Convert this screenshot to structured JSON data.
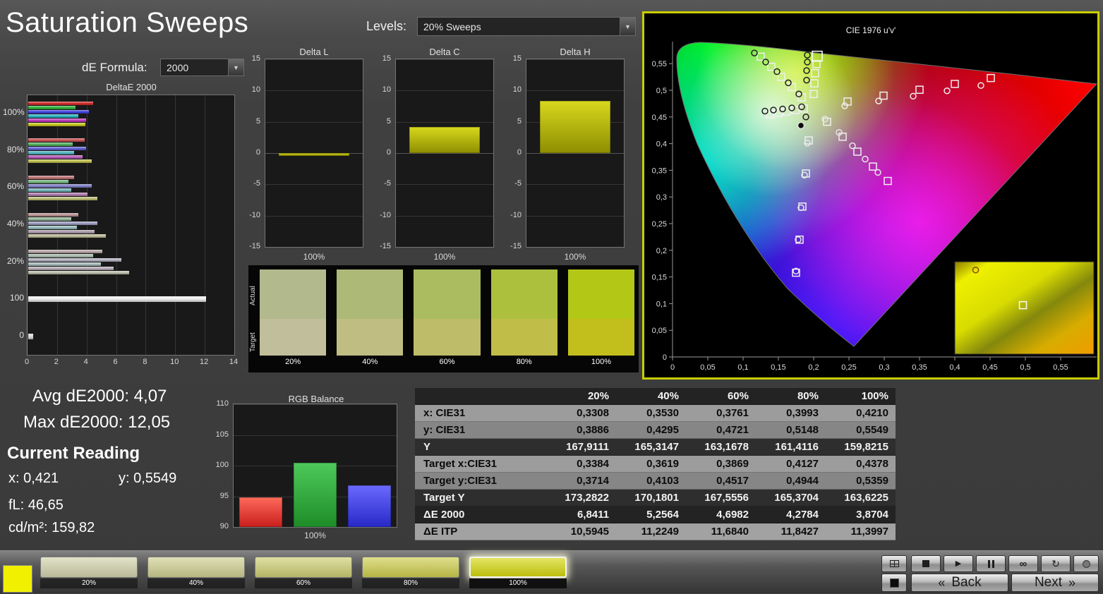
{
  "page": {
    "title": "Saturation Sweeps"
  },
  "controls": {
    "levels_label": "Levels:",
    "levels_value": "20% Sweeps",
    "de_formula_label": "dE Formula:",
    "de_formula_value": "2000",
    "dropdown_arrow": "▼"
  },
  "stats": {
    "avg": "Avg dE2000: 4,07",
    "max": "Max dE2000: 12,05",
    "current_heading": "Current Reading",
    "x": "x: 0,421",
    "y": "y: 0,5549",
    "fl": "fL: 46,65",
    "cdm2": "cd/m²: 159,82"
  },
  "chart_data": [
    {
      "id": "deltaE2000",
      "type": "bar",
      "orientation": "horizontal",
      "title": "DeltaE 2000",
      "xlim": [
        0,
        14
      ],
      "xticks": [
        0,
        2,
        4,
        6,
        8,
        10,
        12,
        14
      ],
      "groups": [
        {
          "label": "100%",
          "values": [
            4.4,
            3.2,
            4.1,
            3.4,
            3.9,
            3.87
          ],
          "colors": [
            "#d22c2c",
            "#30b13c",
            "#4040dd",
            "#2cb4c4",
            "#c238c2",
            "#c6c61e"
          ]
        },
        {
          "label": "80%",
          "values": [
            3.8,
            3.0,
            3.9,
            3.1,
            3.7,
            4.28
          ],
          "colors": [
            "#c85454",
            "#52b25e",
            "#6060d2",
            "#50b4c0",
            "#b85cb8",
            "#c0c04c"
          ]
        },
        {
          "label": "60%",
          "values": [
            3.1,
            2.7,
            4.3,
            2.9,
            4.0,
            4.7
          ],
          "colors": [
            "#c07676",
            "#74b47e",
            "#8080c8",
            "#74b6ba",
            "#b07cb0",
            "#bcbc74"
          ]
        },
        {
          "label": "40%",
          "values": [
            3.4,
            2.9,
            4.7,
            3.3,
            4.5,
            5.26
          ],
          "col": null,
          "colors": [
            "#ba9292",
            "#94b89a",
            "#9e9ec2",
            "#96baba",
            "#ac9cac",
            "#baba96"
          ]
        },
        {
          "label": "20%",
          "values": [
            5.0,
            4.4,
            6.3,
            4.9,
            5.8,
            6.84
          ],
          "colors": [
            "#b8a6a6",
            "#aabcae",
            "#b0b0be",
            "#a8bcbc",
            "#b4aab4",
            "#bcbcaa"
          ]
        },
        {
          "label": "100",
          "values": [
            12.05
          ],
          "colors": [
            "#ececec"
          ]
        },
        {
          "label": "0",
          "values": [
            0.35
          ],
          "colors": [
            "#d8d8d8"
          ]
        }
      ]
    },
    {
      "id": "deltaL",
      "type": "bar",
      "title": "Delta L",
      "xlabel": "100%",
      "ylim": [
        -15,
        15
      ],
      "yticks": [
        15,
        10,
        5,
        0,
        -5,
        -10,
        -15
      ],
      "bars": [
        {
          "value": -0.4,
          "top": "#d8d81e",
          "bottom": "#8e8e02"
        }
      ]
    },
    {
      "id": "deltaC",
      "type": "bar",
      "title": "Delta C",
      "xlabel": "100%",
      "ylim": [
        -15,
        15
      ],
      "yticks": [
        15,
        10,
        5,
        0,
        -5,
        -10,
        -15
      ],
      "bars": [
        {
          "value": 4.2,
          "top": "#d8d81e",
          "bottom": "#8e8e02"
        }
      ]
    },
    {
      "id": "deltaH",
      "type": "bar",
      "title": "Delta H",
      "xlabel": "100%",
      "ylim": [
        -15,
        15
      ],
      "yticks": [
        15,
        10,
        5,
        0,
        -5,
        -10,
        -15
      ],
      "bars": [
        {
          "value": 8.3,
          "top": "#d8d81e",
          "bottom": "#8e8e02"
        }
      ]
    },
    {
      "id": "rgbBalance",
      "type": "bar",
      "title": "RGB Balance",
      "xlabel": "100%",
      "ylim": [
        90,
        110
      ],
      "yticks": [
        110,
        105,
        100,
        95,
        90
      ],
      "bars": [
        {
          "name": "Red",
          "value": 94.8,
          "top": "#ff6a5a",
          "bottom": "#c81e1e"
        },
        {
          "name": "Green",
          "value": 100.5,
          "top": "#4ec95a",
          "bottom": "#1e8c28"
        },
        {
          "name": "Blue",
          "value": 96.8,
          "top": "#6a6aff",
          "bottom": "#2828c8"
        }
      ]
    },
    {
      "id": "cie",
      "type": "scatter",
      "title": "CIE 1976 u'v'",
      "xlim": [
        0,
        0.6
      ],
      "ylim": [
        0,
        0.6
      ],
      "xtick_labels": [
        "0",
        "0,05",
        "0,1",
        "0,15",
        "0,2",
        "0,25",
        "0,3",
        "0,35",
        "0,4",
        "0,45",
        "0,5",
        "0,55"
      ],
      "ytick_labels": [
        "0,55",
        "0,5",
        "0,45",
        "0,4",
        "0,35",
        "0,3",
        "0,25",
        "0,2",
        "0,15",
        "0,1",
        "0,05",
        "0"
      ],
      "series": [
        {
          "name": "red-target",
          "marker": "square",
          "stroke": "#f0f0f0",
          "points": [
            [
              0.248,
              0.479
            ],
            [
              0.299,
              0.49
            ],
            [
              0.35,
              0.501
            ],
            [
              0.4,
              0.512
            ],
            [
              0.451,
              0.523
            ]
          ]
        },
        {
          "name": "red-measured",
          "marker": "circle",
          "stroke": "#f0f0f0",
          "points": [
            [
              0.244,
              0.471
            ],
            [
              0.292,
              0.48
            ],
            [
              0.341,
              0.489
            ],
            [
              0.389,
              0.499
            ],
            [
              0.437,
              0.509
            ]
          ]
        },
        {
          "name": "green-target",
          "marker": "square",
          "stroke": "#f0f0f0",
          "points": [
            [
              0.183,
              0.487
            ],
            [
              0.169,
              0.506
            ],
            [
              0.154,
              0.525
            ],
            [
              0.14,
              0.544
            ],
            [
              0.125,
              0.563
            ]
          ]
        },
        {
          "name": "green-measured",
          "marker": "circle",
          "stroke": "#1e1e1e",
          "points": [
            [
              0.179,
              0.493
            ],
            [
              0.164,
              0.514
            ],
            [
              0.148,
              0.535
            ],
            [
              0.132,
              0.553
            ],
            [
              0.116,
              0.57
            ]
          ]
        },
        {
          "name": "blue-target",
          "marker": "square",
          "stroke": "#f0f0f0",
          "points": [
            [
              0.193,
              0.406
            ],
            [
              0.189,
              0.344
            ],
            [
              0.184,
              0.282
            ],
            [
              0.18,
              0.22
            ],
            [
              0.175,
              0.158
            ]
          ]
        },
        {
          "name": "blue-measured",
          "marker": "circle",
          "stroke": "#e8e8e8",
          "points": [
            [
              0.191,
              0.401
            ],
            [
              0.187,
              0.341
            ],
            [
              0.182,
              0.28
            ],
            [
              0.178,
              0.22
            ],
            [
              0.175,
              0.161
            ]
          ]
        },
        {
          "name": "cyan-target",
          "marker": "square",
          "stroke": "#f0f0f0",
          "points": [
            [
              0.186,
              0.466
            ],
            [
              0.174,
              0.463
            ],
            [
              0.162,
              0.46
            ],
            [
              0.15,
              0.458
            ],
            [
              0.138,
              0.455
            ]
          ]
        },
        {
          "name": "cyan-measured",
          "marker": "circle",
          "stroke": "#1e1e1e",
          "points": [
            [
              0.183,
              0.469
            ],
            [
              0.169,
              0.467
            ],
            [
              0.156,
              0.465
            ],
            [
              0.143,
              0.463
            ],
            [
              0.131,
              0.461
            ]
          ]
        },
        {
          "name": "magenta-target",
          "marker": "square",
          "stroke": "#f0f0f0",
          "points": [
            [
              0.219,
              0.441
            ],
            [
              0.241,
              0.413
            ],
            [
              0.262,
              0.385
            ],
            [
              0.284,
              0.357
            ],
            [
              0.305,
              0.33
            ]
          ]
        },
        {
          "name": "magenta-measured",
          "marker": "circle",
          "stroke": "#e8e8e8",
          "points": [
            [
              0.216,
              0.446
            ],
            [
              0.236,
              0.421
            ],
            [
              0.255,
              0.396
            ],
            [
              0.273,
              0.371
            ],
            [
              0.291,
              0.346
            ]
          ]
        },
        {
          "name": "yellow-target",
          "marker": "square",
          "stroke": "#f0f0f0",
          "points": [
            [
              0.2,
              0.493
            ],
            [
              0.201,
              0.513
            ],
            [
              0.202,
              0.532
            ],
            [
              0.204,
              0.549
            ]
          ]
        },
        {
          "name": "yellow-measured",
          "marker": "circle",
          "stroke": "#1e1e1e",
          "points": [
            [
              0.189,
              0.45
            ],
            [
              0.19,
              0.519
            ],
            [
              0.19,
              0.537
            ],
            [
              0.191,
              0.553
            ],
            [
              0.191,
              0.566
            ]
          ]
        },
        {
          "name": "current-target",
          "marker": "square",
          "stroke": "#ffffff",
          "size": 14,
          "points": [
            [
              0.205,
              0.564
            ]
          ]
        },
        {
          "name": "current-measured",
          "marker": "dot",
          "stroke": "#e0e0e0",
          "fill": "#0a0a0a",
          "size": 9,
          "points": [
            [
              0.182,
              0.434
            ]
          ]
        }
      ],
      "inset": {
        "circle": [
          0.15,
          0.09
        ],
        "square": [
          0.49,
          0.47
        ]
      }
    }
  ],
  "swatch_strip": {
    "row_labels": [
      "Actual",
      "Target"
    ],
    "columns": [
      {
        "label": "20%",
        "actual": "#b2b98c",
        "target": "#c1bf9b"
      },
      {
        "label": "40%",
        "actual": "#adb977",
        "target": "#c0bd82"
      },
      {
        "label": "60%",
        "actual": "#aabc5f",
        "target": "#bfbc69"
      },
      {
        "label": "80%",
        "actual": "#adc03e",
        "target": "#c0bd48"
      },
      {
        "label": "100%",
        "actual": "#b3c716",
        "target": "#c2bf1d"
      }
    ]
  },
  "table": {
    "columns": [
      "20%",
      "40%",
      "60%",
      "80%",
      "100%"
    ],
    "rows": [
      {
        "label": "x: CIE31",
        "tone": "light",
        "values": [
          "0,3308",
          "0,3530",
          "0,3761",
          "0,3993",
          "0,4210"
        ]
      },
      {
        "label": "y: CIE31",
        "tone": "mid",
        "values": [
          "0,3886",
          "0,4295",
          "0,4721",
          "0,5148",
          "0,5549"
        ]
      },
      {
        "label": "Y",
        "tone": "dark",
        "values": [
          "167,9111",
          "165,3147",
          "163,1678",
          "161,4116",
          "159,8215"
        ]
      },
      {
        "label": "Target x:CIE31",
        "tone": "light",
        "values": [
          "0,3384",
          "0,3619",
          "0,3869",
          "0,4127",
          "0,4378"
        ]
      },
      {
        "label": "Target y:CIE31",
        "tone": "mid",
        "values": [
          "0,3714",
          "0,4103",
          "0,4517",
          "0,4944",
          "0,5359"
        ]
      },
      {
        "label": "Target Y",
        "tone": "dark",
        "values": [
          "173,2822",
          "170,1801",
          "167,5556",
          "165,3704",
          "163,6225"
        ]
      },
      {
        "label": "ΔE 2000",
        "tone": "darker",
        "values": [
          "6,8411",
          "5,2564",
          "4,6982",
          "4,2784",
          "3,8704"
        ]
      },
      {
        "label": "ΔE ITP",
        "tone": "light2",
        "values": [
          "10,5945",
          "11,2249",
          "11,6840",
          "11,8427",
          "11,3997"
        ]
      }
    ]
  },
  "bottom_bar": {
    "current_swatch_color": "#f0f000",
    "swatches": [
      {
        "label": "20%",
        "color": "#d3d3ad",
        "selected": false
      },
      {
        "label": "40%",
        "color": "#cfcf92",
        "selected": false
      },
      {
        "label": "60%",
        "color": "#cece74",
        "selected": false
      },
      {
        "label": "80%",
        "color": "#cece4e",
        "selected": false
      },
      {
        "label": "100%",
        "color": "#d6d810",
        "selected": true
      }
    ],
    "back_label": "Back",
    "next_label": "Next",
    "back_chevron": "«",
    "next_chevron": "»",
    "icons": {
      "play": "▶",
      "infinity": "∞",
      "refresh": "↻"
    }
  }
}
